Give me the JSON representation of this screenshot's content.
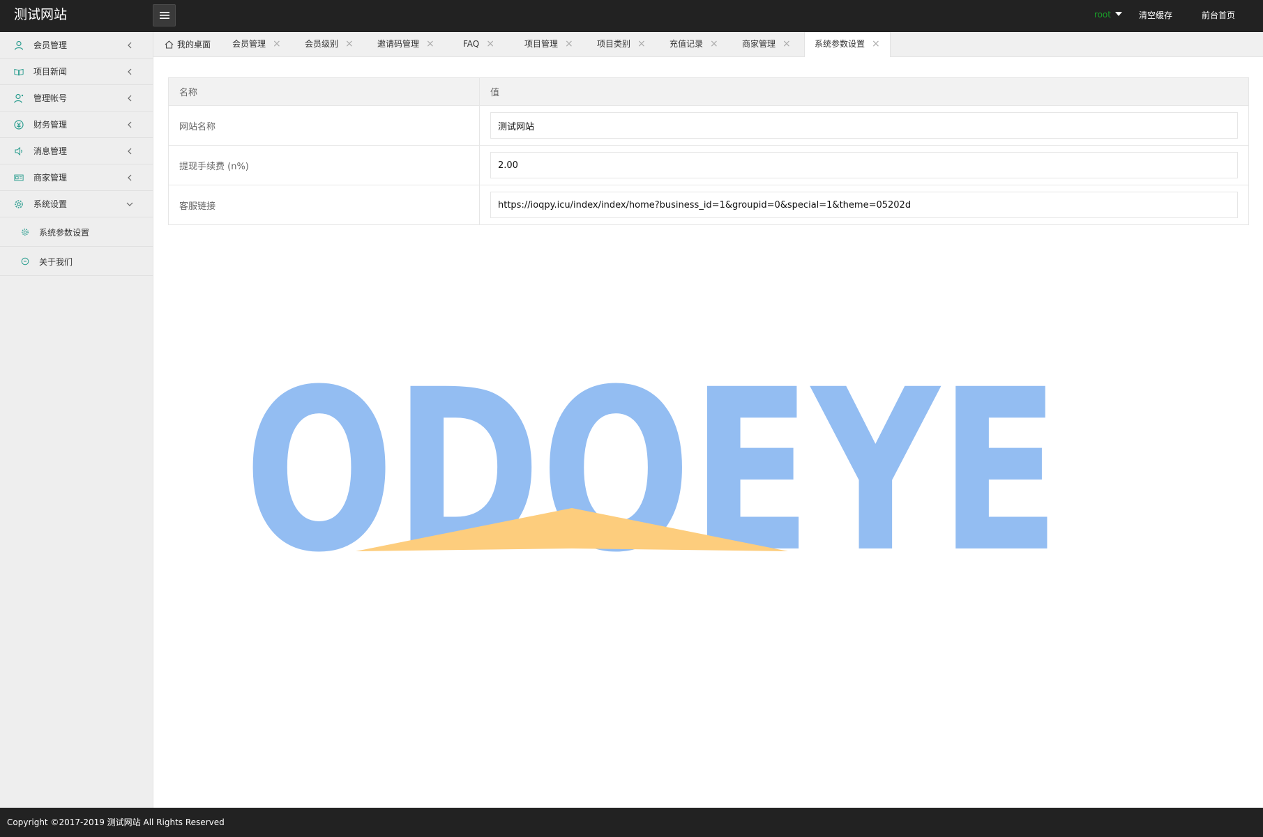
{
  "header": {
    "site_title": "测试网站",
    "user_name": "root",
    "clear_cache": "清空缓存",
    "front_home": "前台首页"
  },
  "sidebar": {
    "items": [
      {
        "label": "会员管理",
        "icon": "user-icon"
      },
      {
        "label": "项目新闻",
        "icon": "book-icon"
      },
      {
        "label": "管理帐号",
        "icon": "admin-user-icon"
      },
      {
        "label": "财务管理",
        "icon": "finance-icon"
      },
      {
        "label": "消息管理",
        "icon": "speaker-icon"
      },
      {
        "label": "商家管理",
        "icon": "merchant-card-icon"
      },
      {
        "label": "系统设置",
        "icon": "gear-icon"
      }
    ],
    "sub_items": [
      {
        "label": "系统参数设置",
        "icon": "gear-small-icon"
      },
      {
        "label": "关于我们",
        "icon": "info-circle-icon"
      }
    ]
  },
  "tabs": {
    "home": "我的桌面",
    "items": [
      "会员管理",
      "会员级别",
      "邀请码管理",
      "FAQ",
      "项目管理",
      "项目类别",
      "充值记录",
      "商家管理"
    ],
    "active": "系统参数设置",
    "close_glyph": "×"
  },
  "table": {
    "headers": [
      "名称",
      "值"
    ],
    "rows": [
      {
        "name": "网站名称",
        "value": "测试网站"
      },
      {
        "name": "提现手续费 (n%)",
        "value": "2.00"
      },
      {
        "name": "客服链接",
        "value": "https://ioqpy.icu/index/index/home?business_id=1&groupid=0&special=1&theme=05202d"
      }
    ]
  },
  "watermark": {
    "text": "ODOEYE",
    "color": "#93bdf2",
    "accent": "#fdcd7d"
  },
  "footer": {
    "copyright": "Copyright ©2017-2019 测试网站 All Rights Reserved"
  },
  "colors": {
    "header_bg": "#222222",
    "sidebar_bg": "#eeeeee",
    "user_green": "#1a9f29",
    "icon_teal": "#2a9d8f"
  }
}
